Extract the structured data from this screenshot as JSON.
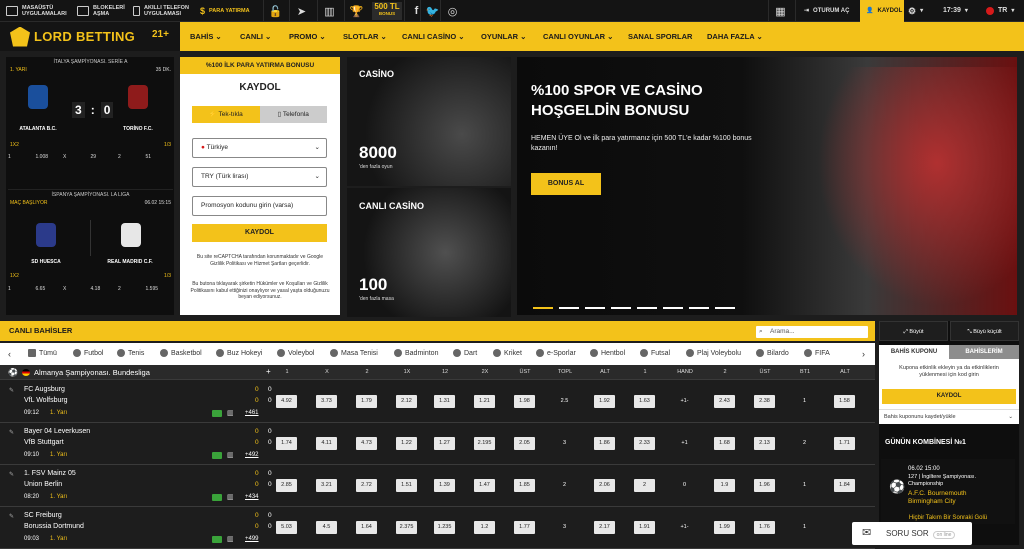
{
  "topbar": {
    "desktop_apps": "MASAÜSTÜ UYGULAMALARI",
    "unblock": "BLOKELERİ AŞMA",
    "phone_apps": "AKILLI TELEFON UYGULAMASI",
    "deposit": "PARA YATIRMA",
    "bonus_amount": "500 TL",
    "bonus_sub": "BONUS",
    "login": "OTURUM AÇ",
    "register": "KAYDOL",
    "time": "17:39",
    "lang": "TR"
  },
  "nav": {
    "brand": "LORD BETTING",
    "badge": "21+",
    "items": [
      "BAHİS",
      "CANLI",
      "PROMO",
      "SLOTLAR",
      "CANLI CASİNO",
      "OYUNLAR",
      "CANLI OYUNLAR",
      "SANAL SPORLAR",
      "DAHA FAZLA"
    ]
  },
  "live_matches": [
    {
      "league": "İTALYA ŞAMPİYONASI. SERİE A",
      "status": "1. YARI",
      "minute": "35 DK.",
      "home": "ATALANTA B.C.",
      "away": "TORİNO F.C.",
      "score_home": "3",
      "score_away": "0",
      "market": "1X2",
      "page": "1/3",
      "odds": [
        "1",
        "1.008",
        "X",
        "29",
        "2",
        "51"
      ]
    },
    {
      "league": "İSPANYA ŞAMPİYONASI. LA LIGA",
      "status": "MAÇ BAŞLIYOR",
      "minute": "06.02 15:15",
      "home": "SD HUESCA",
      "away": "REAL MADRID C.F.",
      "market": "1X2",
      "page": "1/3",
      "odds": [
        "1",
        "6.65",
        "X",
        "4.18",
        "2",
        "1.595"
      ]
    }
  ],
  "register": {
    "banner": "%100 İLK PARA YATIRMA BONUSU",
    "title": "KAYDOL",
    "tab_one": "Tek-tıkla",
    "tab_phone": "Telefonla",
    "country": "Türkiye",
    "currency": "TRY (Türk lirası)",
    "promo_placeholder": "Promosyon kodunu girin (varsa)",
    "button": "KAYDOL",
    "recaptcha": "Bu site reCAPTCHA tarafından korunmaktadır ve Google Gizlilik Politikası ve Hizmet Şartları geçerlidir.",
    "terms": "Bu butona tıklayarak şirketin Hükümler ve Koşulları ve Gizlilik Politikasını kabul ettiğinizi onaylıyor ve yasal yaşta olduğunuzu beyan ediyorsunuz."
  },
  "tiles": [
    {
      "title": "CASİNO",
      "number": "8000",
      "sub": "'den fazla oyun"
    },
    {
      "title": "CANLI CASİNO",
      "number": "100",
      "sub": "'den fazla masa"
    }
  ],
  "hero": {
    "line1": "%100 SPOR VE CASİNO",
    "line2": "HOŞGELDİN BONUSU",
    "text": "HEMEN ÜYE Ol ve ilk para yatırmanız için 500 TL'e kadar %100 bonus kazanın!",
    "button": "BONUS AL"
  },
  "live": {
    "title": "CANLI BAHİSLER",
    "search_placeholder": "Arama...",
    "sports": [
      "Tümü",
      "Futbol",
      "Tenis",
      "Basketbol",
      "Buz Hokeyi",
      "Voleybol",
      "Masa Tenisi",
      "Badminton",
      "Dart",
      "Kriket",
      "e-Sporlar",
      "Hentbol",
      "Futsal",
      "Plaj Voleybolu",
      "Bilardo",
      "FIFA"
    ],
    "league": "Almanya Şampiyonası. Bundesliga",
    "columns": [
      "1",
      "X",
      "2",
      "1X",
      "12",
      "2X",
      "ÜST",
      "TOPL",
      "ALT",
      "1",
      "HAND",
      "2",
      "ÜST",
      "BT1",
      "ALT"
    ],
    "matches": [
      {
        "home": "FC Augsburg",
        "away": "VfL Wolfsburg",
        "score_h": "0",
        "score_a": "0",
        "time": "09:12",
        "half": "1. Yarı",
        "more": "+461",
        "odds": [
          "4.92",
          "3.73",
          "1.79",
          "2.12",
          "1.31",
          "1.21",
          "1.98",
          "2.5",
          "1.92",
          "1.63",
          "+1-",
          "2.43",
          "2.38",
          "1",
          "1.58"
        ]
      },
      {
        "home": "Bayer 04 Leverkusen",
        "away": "VfB Stuttgart",
        "score_h": "0",
        "score_a": "0",
        "time": "09:10",
        "half": "1. Yarı",
        "more": "+492",
        "odds": [
          "1.74",
          "4.11",
          "4.73",
          "1.22",
          "1.27",
          "2.195",
          "2.05",
          "3",
          "1.86",
          "2.33",
          "+1",
          "1.68",
          "2.13",
          "2",
          "1.71"
        ]
      },
      {
        "home": "1. FSV Mainz 05",
        "away": "Union Berlin",
        "score_h": "0",
        "score_a": "0",
        "time": "08:20",
        "half": "1. Yarı",
        "more": "+434",
        "odds": [
          "2.85",
          "3.21",
          "2.72",
          "1.51",
          "1.39",
          "1.47",
          "1.85",
          "2",
          "2.06",
          "2",
          "0",
          "1.9",
          "1.96",
          "1",
          "1.84"
        ]
      },
      {
        "home": "SC Freiburg",
        "away": "Borussia Dortmund",
        "score_h": "0",
        "score_a": "0",
        "time": "09:03",
        "half": "1. Yarı",
        "more": "+499",
        "odds": [
          "5.03",
          "4.5",
          "1.64",
          "2.375",
          "1.235",
          "1.2",
          "1.77",
          "3",
          "2.17",
          "1.91",
          "+1-",
          "1.99",
          "1.76",
          "1",
          ""
        ]
      }
    ]
  },
  "right": {
    "big": "Büyüt",
    "small": "Büyü küçült",
    "tab_coupon": "BAHİS KUPONU",
    "tab_bets": "BAHİSLERİM",
    "coupon_text": "Kupona etkinlik ekleyin ya da etkinliklerin yüklenmesi için kod girin",
    "coupon_btn": "KAYDOL",
    "save": "Bahis kuponunu kaydet/yükle",
    "combo_title": "GÜNÜN KOMBİNESİ №1",
    "combo_time": "06.02  15:00",
    "combo_league": "127 | İngiltere Şampiyonası. Championship",
    "combo_home": "A.F.C. Bournemouth",
    "combo_away": "Birmingham City",
    "combo_bottom": "Hiçbir Takım Bir Sonraki Golü",
    "chat": "SORU SOR",
    "chat_status": "on line"
  },
  "colors": {
    "accent": "#f3c21a",
    "dark": "#141414"
  }
}
